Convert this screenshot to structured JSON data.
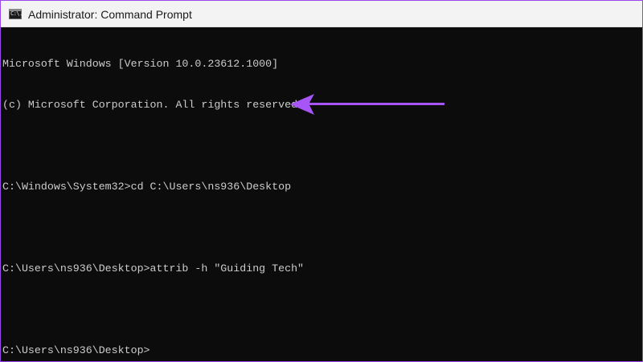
{
  "window": {
    "title": "Administrator: Command Prompt",
    "icon": "cmd-icon",
    "icon_glyph": "C:\\."
  },
  "console": {
    "lines": [
      "Microsoft Windows [Version 10.0.23612.1000]",
      "(c) Microsoft Corporation. All rights reserved.",
      "",
      "C:\\Windows\\System32>cd C:\\Users\\ns936\\Desktop",
      "",
      "C:\\Users\\ns936\\Desktop>attrib -h \"Guiding Tech\"",
      "",
      "C:\\Users\\ns936\\Desktop>"
    ]
  },
  "annotation": {
    "icon": "arrow-left-icon",
    "color": "#a855f7"
  },
  "colors": {
    "frame": "#9b45f0",
    "console_bg": "#0c0c0c",
    "console_text": "#cccccc",
    "titlebar_bg": "#f3f3f3"
  }
}
